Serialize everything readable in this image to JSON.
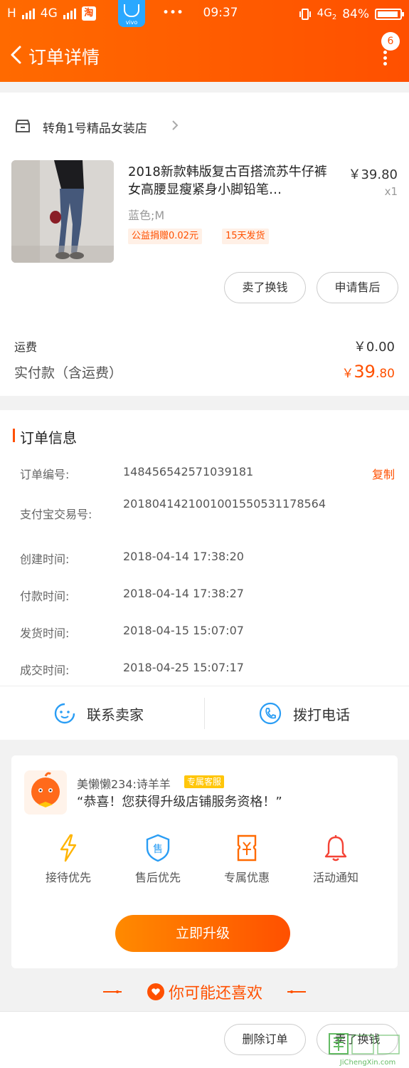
{
  "status_bar": {
    "carrier": "H",
    "network": "4G",
    "app_badge": "淘",
    "phone_brand": "vivo",
    "dots": "•••",
    "time": "09:37",
    "network_right": "4G",
    "network_sub": "2",
    "battery": "84%"
  },
  "header": {
    "title": "订单详情",
    "notification_count": "6"
  },
  "shop": {
    "name": "转角1号精品女装店"
  },
  "item": {
    "title": "2018新款韩版复古百搭流苏牛仔裤女高腰显瘦紧身小脚铅笔…",
    "price": "￥39.80",
    "quantity": "x1",
    "spec": "蓝色;M",
    "tags": [
      "公益捐赠0.02元",
      "15天发货"
    ],
    "actions": [
      "卖了换钱",
      "申请售后"
    ]
  },
  "fees": {
    "shipping_label": "运费",
    "shipping_value": "￥0.00",
    "paid_label": "实付款（含运费）",
    "paid_currency": "￥",
    "paid_int": "39",
    "paid_dec": ".80"
  },
  "order_info": {
    "title": "订单信息",
    "copy_label": "复制",
    "rows": [
      {
        "label": "订单编号:",
        "value": "148456542571039181"
      },
      {
        "label": "支付宝交易号:",
        "value": "2018041421001001550531178564"
      },
      {
        "label": "创建时间:",
        "value": "2018-04-14 17:38:20"
      },
      {
        "label": "付款时间:",
        "value": "2018-04-14 17:38:27"
      },
      {
        "label": "发货时间:",
        "value": "2018-04-15 15:07:07"
      },
      {
        "label": "成交时间:",
        "value": "2018-04-25 15:07:17"
      }
    ],
    "contact_seller": "联系卖家",
    "call_phone": "拨打电话"
  },
  "upgrade": {
    "cs_name": "美懒懒234:诗羊羊",
    "cs_badge": "专属客服",
    "message": "“恭喜！您获得升级店铺服务资格！”",
    "perks": [
      "接待优先",
      "售后优先",
      "专属优惠",
      "活动通知"
    ],
    "perk_icon_char": "售",
    "button": "立即升级"
  },
  "recommend": {
    "text": "你可能还喜欢"
  },
  "bottom_actions": [
    "删除订单",
    "卖了换钱"
  ],
  "watermark": {
    "logo_text": "JiChengXin.com"
  },
  "colors": {
    "brand": "#ff5000",
    "header_start": "#ff6a00",
    "background": "#f2f2f2"
  }
}
